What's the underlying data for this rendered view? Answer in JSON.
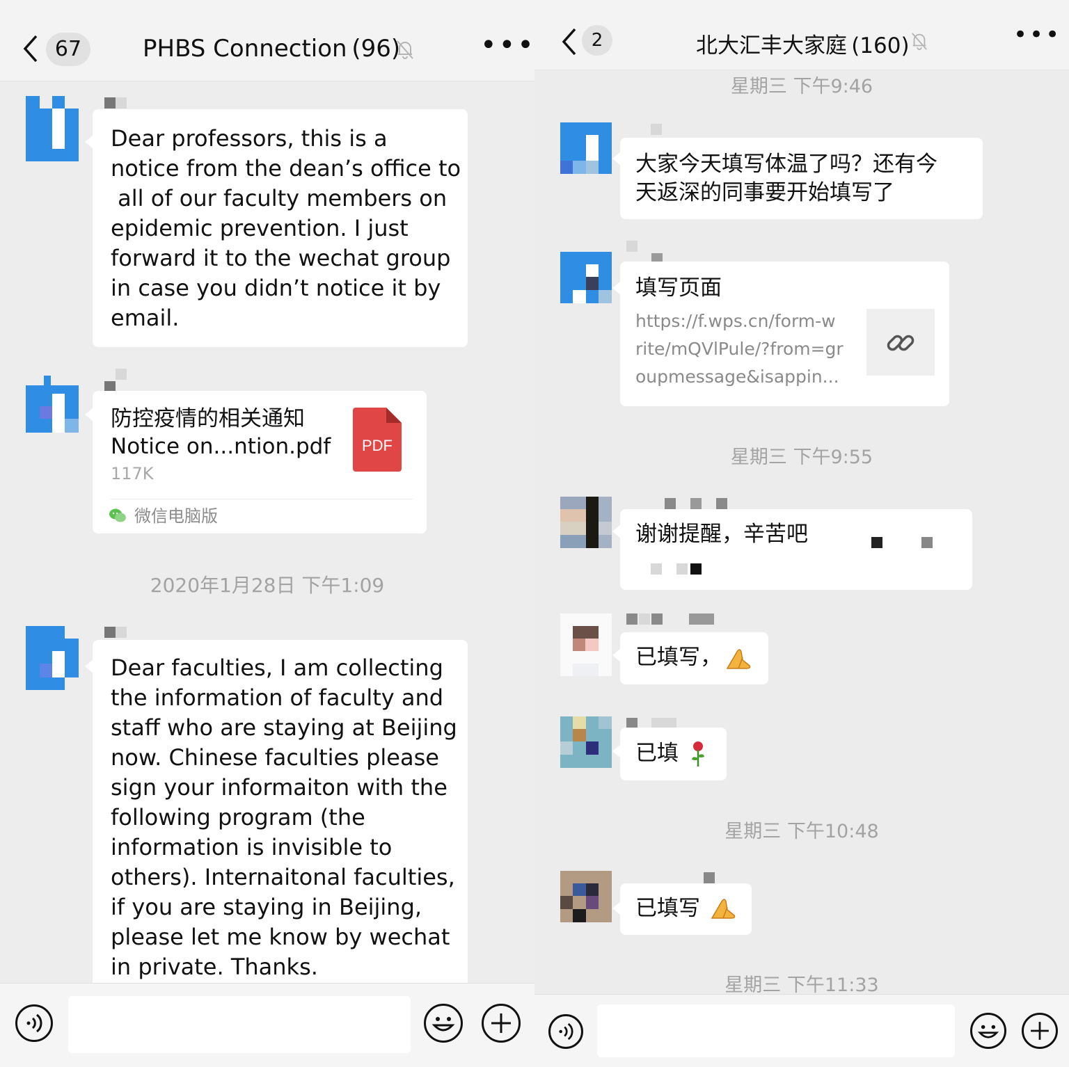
{
  "left": {
    "header": {
      "badge": "67",
      "title": "PHBS Connection (96)"
    },
    "messages": {
      "m1": "Dear professors, this is a\nnotice from the dean’s office to\n all of our faculty members on\nepidemic prevention. I just\nforward it to the wechat group\nin case you didn’t notice it by\nemail.",
      "file": {
        "title_cn": "防控疫情的相关通知",
        "filename": "Notice on...ntion.pdf",
        "size": "117K",
        "badge": "PDF",
        "source": "微信电脑版"
      },
      "timestamp": "2020年1月28日 下午1:09",
      "m2": "Dear faculties, I am collecting\nthe information of faculty and\nstaff who are staying at Beijing\nnow. Chinese faculties please\nsign your informaiton with the\nfollowing program (the\ninformation is invisible to\nothers). Internaitonal faculties,\nif you are staying in Beijing,\nplease let me know by wechat\nin private. Thanks."
    }
  },
  "right": {
    "header": {
      "badge": "2",
      "title": "北大汇丰大家庭 (160)"
    },
    "timestamps": [
      "星期三 下午9:46",
      "星期三 下午9:55",
      "星期三 下午10:48",
      "星期三 下午11:33"
    ],
    "messages": {
      "m1": "大家今天填写体温了吗？还有今\n天返深的同事要开始填写了",
      "link": {
        "title": "填写页面",
        "url": "https://f.wps.cn/form-w\nrite/mQVlPule/?from=gr\noupmessage&isappin..."
      },
      "m3": "谢谢提醒，辛苦吧",
      "m4": "已填写，",
      "m5": "已填",
      "m6": "已填写"
    }
  },
  "colors": {
    "accent_blue": "#2f8de4",
    "pdf_red": "#e04646",
    "wechat_green": "#59c14e"
  }
}
